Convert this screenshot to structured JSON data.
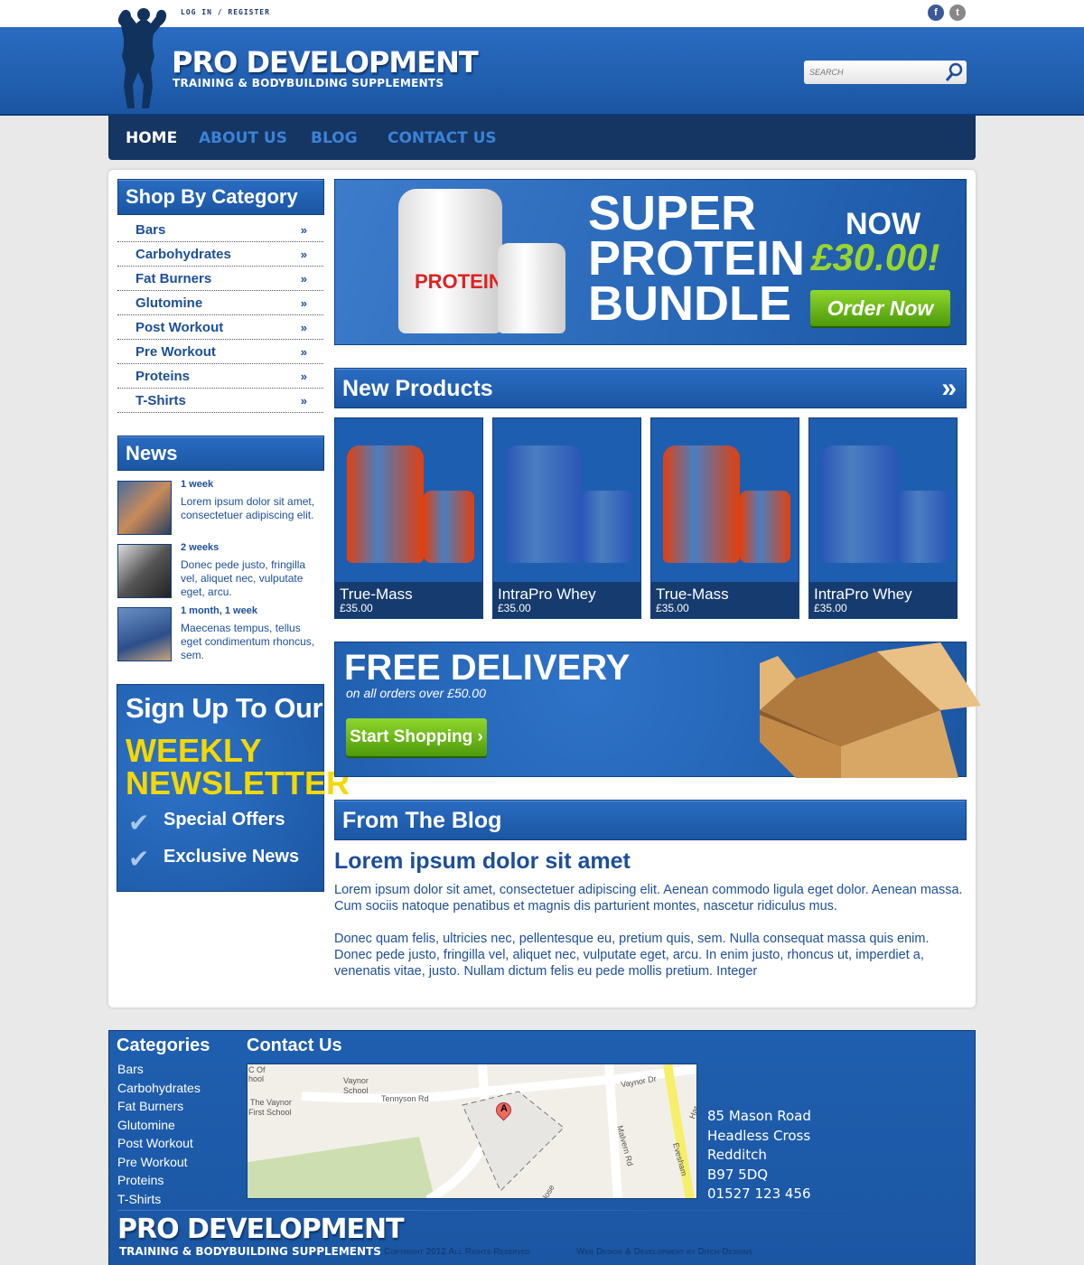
{
  "top": {
    "login": "LOG IN",
    "sep": "/",
    "register": "REGISTER",
    "social": [
      {
        "icon": "facebook-icon",
        "glyph": "f",
        "color": "#3b5998"
      },
      {
        "icon": "twitter-icon",
        "glyph": "t",
        "color": "#888888"
      }
    ]
  },
  "brand": {
    "title": "PRO DEVELOPMENT",
    "subtitle": "TRAINING & BODYBUILDING SUPPLEMENTS"
  },
  "search": {
    "placeholder": "SEARCH"
  },
  "nav": [
    {
      "label": "HOME",
      "active": true
    },
    {
      "label": "ABOUT US"
    },
    {
      "label": "BLOG"
    },
    {
      "label": "CONTACT US"
    }
  ],
  "sidebar": {
    "categories_title": "Shop By Category",
    "categories": [
      "Bars",
      "Carbohydrates",
      "Fat Burners",
      "Glutomine",
      "Post Workout",
      "Pre Workout",
      "Proteins",
      "T-Shirts"
    ],
    "chevron": "»",
    "news_title": "News",
    "news": [
      {
        "time": "1 week",
        "text": "Lorem ipsum dolor sit amet, consectetuer adipiscing elit."
      },
      {
        "time": "2 weeks",
        "text": "Donec pede justo, fringilla vel, aliquet nec, vulputate eget, arcu."
      },
      {
        "time": "1 month, 1 week",
        "text": "Maecenas tempus, tellus eget condimentum rhoncus, sem."
      }
    ],
    "newsletter": {
      "line1": "Sign Up To Our",
      "line2": "WEEKLY",
      "line3": "NEWSLETTER",
      "items": [
        "Special Offers",
        "Exclusive News"
      ]
    }
  },
  "banner": {
    "l1": "SUPER",
    "l2": "PROTEIN",
    "l3": "BUNDLE",
    "now": "NOW",
    "price": "£30.00!",
    "button": "Order Now"
  },
  "products": {
    "title": "New Products",
    "items": [
      {
        "name": "True-Mass",
        "price": "£35.00",
        "color": "#e0400f"
      },
      {
        "name": "IntraPro Whey",
        "price": "£35.00",
        "color": "#2a56b8"
      },
      {
        "name": "True-Mass",
        "price": "£35.00",
        "color": "#e0400f"
      },
      {
        "name": "IntraPro Whey",
        "price": "£35.00",
        "color": "#2a56b8"
      }
    ]
  },
  "delivery": {
    "title": "FREE DELIVERY",
    "sub": "on all orders over £50.00",
    "button": "Start Shopping ›"
  },
  "blog": {
    "header": "From The Blog",
    "title": "Lorem ipsum dolor sit amet",
    "p1": "Lorem ipsum dolor sit amet, consectetuer adipiscing elit. Aenean commodo ligula eget dolor. Aenean massa. Cum sociis natoque penatibus et magnis dis parturient montes, nascetur ridiculus mus.",
    "p2": "Donec quam felis, ultricies nec, pellentesque eu, pretium quis, sem. Nulla consequat massa quis enim. Donec pede justo, fringilla vel, aliquet nec, vulputate eget, arcu. In enim justo, rhoncus ut, imperdiet a, venenatis vitae, justo. Nullam dictum felis eu pede mollis pretium. Integer"
  },
  "footer": {
    "categories_title": "Categories",
    "contact_title": "Contact Us",
    "address": [
      "85 Mason Road",
      "Headless Cross",
      "Redditch",
      "B97 5DQ",
      "01527 123 456"
    ],
    "map_labels": {
      "a": "C Of",
      "b": "hool",
      "c": "Vaynor",
      "d": "School",
      "e": "Tennyson Rd",
      "f": "The Vaynor",
      "g": "First School",
      "h": "Vaynor Dr",
      "i": "Malvern Rd",
      "j": "Evesham",
      "k": "Har",
      "l": "lose",
      "marker": "A"
    },
    "copyright": "Copyright 2012 All Rights Reserved",
    "credit": "Web Design & Development by Ditch-Designs"
  }
}
